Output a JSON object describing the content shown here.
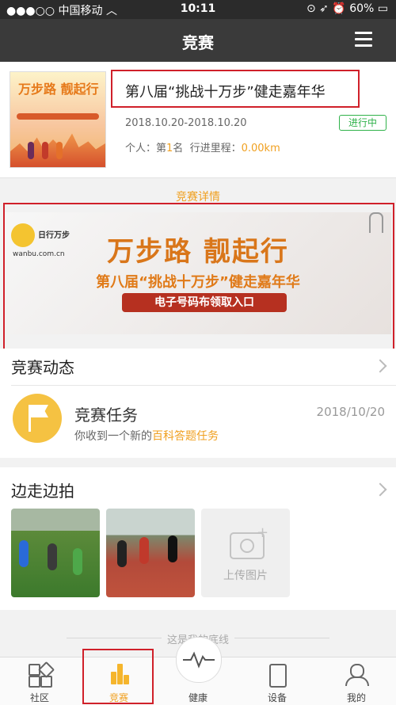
{
  "status_bar": {
    "carrier": "中国移动",
    "time": "10:11",
    "battery": "60%"
  },
  "nav": {
    "title": "竞赛"
  },
  "event": {
    "title": "第八届“挑战十万步”健走嘉年华",
    "dates": "2018.10.20-2018.10.20",
    "status": "进行中",
    "rank_label": "个人：第",
    "rank_value": "1",
    "rank_suffix": "名",
    "distance_label": "行进里程：",
    "distance_value": "0.00km",
    "thumb_title": "万步路 靓起行"
  },
  "detail_label": "竞赛详情",
  "banner": {
    "logo_text": "日行万步",
    "logo_url": "wanbu.com.cn",
    "main": "万步路 靓起行",
    "sub": "第八届“挑战十万步”健走嘉年华",
    "button": "电子号码布领取入口"
  },
  "dynamics": {
    "title": "竞赛动态"
  },
  "task": {
    "title": "竞赛任务",
    "date": "2018/10/20",
    "desc_prefix": "你收到一个新的",
    "desc_link": "百科答题任务"
  },
  "photos": {
    "title": "边走边拍",
    "upload_label": "上传图片"
  },
  "bottom_line": "这是我的底线",
  "tabs": [
    {
      "label": "社区"
    },
    {
      "label": "竞赛"
    },
    {
      "label": "健康"
    },
    {
      "label": "设备"
    },
    {
      "label": "我的"
    }
  ],
  "colors": {
    "accent": "#f0a020",
    "status_green": "#2fb24a",
    "highlight_red": "#d0202a"
  }
}
